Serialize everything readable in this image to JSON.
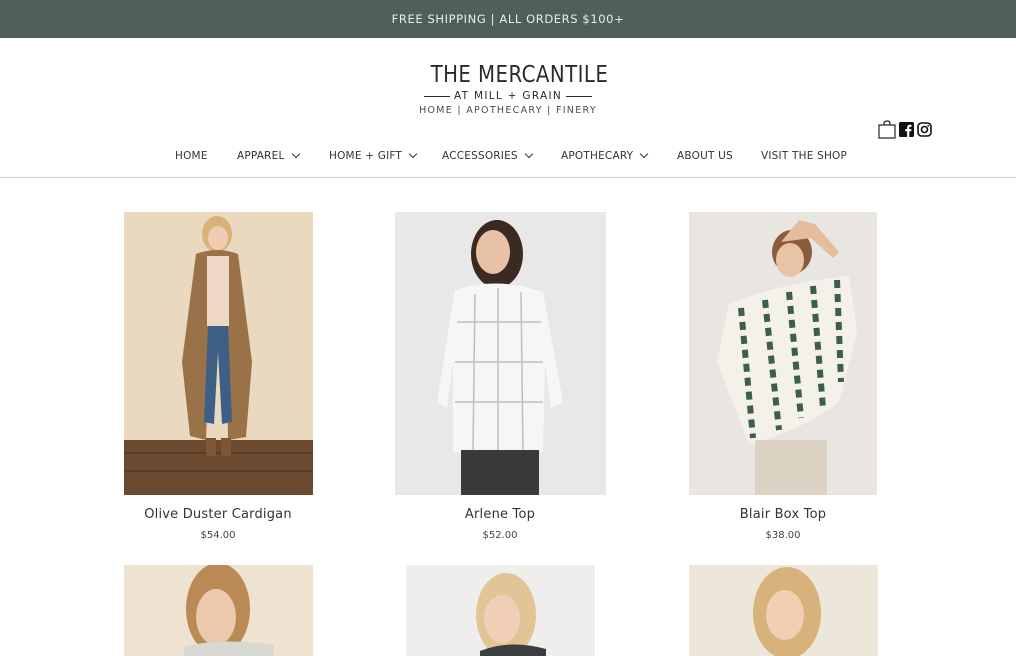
{
  "announcement": "FREE SHIPPING | ALL ORDERS $100+",
  "logo": {
    "name": "THE MERCANTILE",
    "sub": "AT MILL + GRAIN",
    "tagline": "HOME | APOTHECARY | FINERY"
  },
  "icons": {
    "cart": "shopping-bag-icon",
    "facebook": "facebook-icon",
    "instagram": "instagram-icon"
  },
  "nav": [
    {
      "label": "HOME",
      "dropdown": false
    },
    {
      "label": "APPAREL",
      "dropdown": true
    },
    {
      "label": "HOME + GIFT",
      "dropdown": true
    },
    {
      "label": "ACCESSORIES",
      "dropdown": true
    },
    {
      "label": "APOTHECARY",
      "dropdown": true
    },
    {
      "label": "ABOUT US",
      "dropdown": false
    },
    {
      "label": "VISIT THE SHOP",
      "dropdown": false
    }
  ],
  "products": [
    {
      "name": "Olive Duster Cardigan",
      "price": "$54.00"
    },
    {
      "name": "Arlene Top",
      "price": "$52.00"
    },
    {
      "name": "Blair Box Top",
      "price": "$38.00"
    },
    {
      "name": "",
      "price": ""
    },
    {
      "name": "",
      "price": ""
    },
    {
      "name": "",
      "price": ""
    }
  ],
  "colors": {
    "announcement_bg": "#4f5f5b",
    "text": "#333333",
    "divider": "#cfcfcf"
  }
}
